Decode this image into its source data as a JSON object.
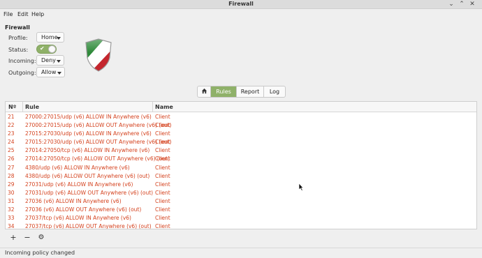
{
  "window": {
    "title": "Firewall"
  },
  "menu": {
    "file": "File",
    "edit": "Edit",
    "help": "Help"
  },
  "section_title": "Firewall",
  "form": {
    "profile_label": "Profile:",
    "profile_value": "Home",
    "status_label": "Status:",
    "status_on": true,
    "incoming_label": "Incoming:",
    "incoming_value": "Deny",
    "outgoing_label": "Outgoing:",
    "outgoing_value": "Allow"
  },
  "tabs": {
    "home_icon": "home-icon",
    "rules": "Rules",
    "report": "Report",
    "log": "Log",
    "active": "Rules"
  },
  "table": {
    "headers": {
      "no": "Nº",
      "rule": "Rule",
      "name": "Name"
    },
    "rows": [
      {
        "no": "21",
        "rule": "27000:27015/udp (v6) ALLOW IN Anywhere (v6)",
        "name": "Client"
      },
      {
        "no": "22",
        "rule": "27000:27015/udp (v6) ALLOW OUT Anywhere (v6) (out)",
        "name": "Client"
      },
      {
        "no": "23",
        "rule": "27015:27030/udp (v6) ALLOW IN Anywhere (v6)",
        "name": "Client"
      },
      {
        "no": "24",
        "rule": "27015:27030/udp (v6) ALLOW OUT Anywhere (v6) (out)",
        "name": "Client"
      },
      {
        "no": "25",
        "rule": "27014:27050/tcp (v6) ALLOW IN Anywhere (v6)",
        "name": "Client"
      },
      {
        "no": "26",
        "rule": "27014:27050/tcp (v6) ALLOW OUT Anywhere (v6) (out)",
        "name": "Client"
      },
      {
        "no": "27",
        "rule": "4380/udp (v6) ALLOW IN Anywhere (v6)",
        "name": "Client"
      },
      {
        "no": "28",
        "rule": "4380/udp (v6) ALLOW OUT Anywhere (v6) (out)",
        "name": "Client"
      },
      {
        "no": "29",
        "rule": "27031/udp (v6) ALLOW IN Anywhere (v6)",
        "name": "Client"
      },
      {
        "no": "30",
        "rule": "27031/udp (v6) ALLOW OUT Anywhere (v6) (out)",
        "name": "Client"
      },
      {
        "no": "31",
        "rule": "27036 (v6) ALLOW IN Anywhere (v6)",
        "name": "Client"
      },
      {
        "no": "32",
        "rule": "27036 (v6) ALLOW OUT Anywhere (v6) (out)",
        "name": "Client"
      },
      {
        "no": "33",
        "rule": "27037/tcp (v6) ALLOW IN Anywhere (v6)",
        "name": "Client"
      },
      {
        "no": "34",
        "rule": "27037/tcp (v6) ALLOW OUT Anywhere (v6) (out)",
        "name": "Client"
      }
    ]
  },
  "toolbar": {
    "add": "+",
    "remove": "−",
    "settings": "⚙"
  },
  "statusbar": {
    "text": "Incoming policy changed"
  },
  "colors": {
    "accent": "#8fb169",
    "rule_text": "#d4411d"
  }
}
